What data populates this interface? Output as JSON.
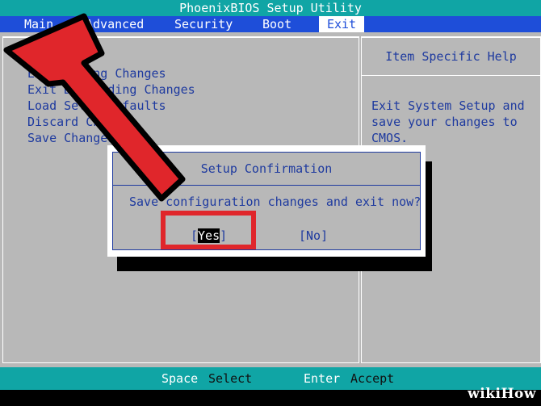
{
  "title": "PhoenixBIOS Setup Utility",
  "menu": [
    {
      "label": "Main"
    },
    {
      "label": "Advanced"
    },
    {
      "label": "Security"
    },
    {
      "label": "Boot"
    },
    {
      "label": "Exit"
    }
  ],
  "exit_items": [
    "Exit Saving Changes",
    "Exit Discarding Changes",
    "Load Setup Defaults",
    "Discard Changes",
    "Save Changes"
  ],
  "help": {
    "title": "Item Specific Help",
    "text": "Exit System Setup and\nsave your changes to\nCMOS."
  },
  "dialog": {
    "title": "Setup Confirmation",
    "message": "Save configuration changes and exit now?",
    "yes_open": "[",
    "yes_label": "Yes",
    "yes_close": "]",
    "no_label": "[No]"
  },
  "status": [
    {
      "key": "Space",
      "desc": "Select"
    },
    {
      "key": "Enter",
      "desc": "Accept"
    }
  ],
  "watermark": "wikiHow",
  "colors": {
    "bios_gray": "#b8b8b8",
    "bios_blue": "#1e3a9f",
    "menu_blue": "#1e4ed9",
    "teal": "#10a5a5",
    "arrow_red": "#e0262b"
  }
}
